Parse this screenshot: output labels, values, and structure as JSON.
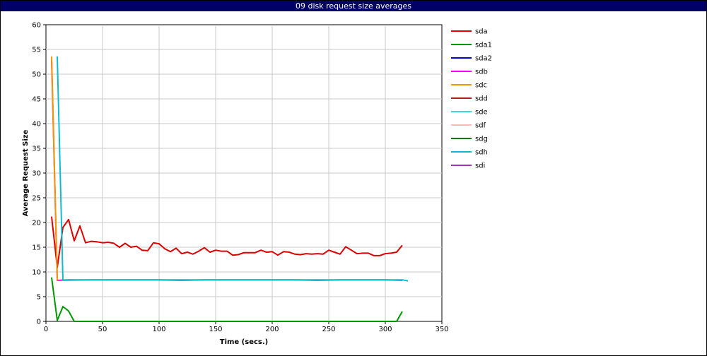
{
  "chart_data": {
    "type": "line",
    "title": "09 disk request size averages",
    "xlabel": "Time (secs.)",
    "ylabel": "Average Request Size",
    "xlim": [
      0,
      350
    ],
    "ylim": [
      0,
      60
    ],
    "xticks": [
      0,
      50,
      100,
      150,
      200,
      250,
      300,
      350
    ],
    "yticks": [
      0,
      5,
      10,
      15,
      20,
      25,
      30,
      35,
      40,
      45,
      50,
      55,
      60
    ],
    "grid": true,
    "legend_position": "right",
    "series": [
      {
        "name": "sda",
        "color": "#dd0000",
        "points": [
          [
            5,
            21.2
          ],
          [
            10,
            10.9
          ],
          [
            15,
            19
          ],
          [
            20,
            20.6
          ],
          [
            25,
            16.3
          ],
          [
            30,
            19.3
          ],
          [
            35,
            15.9
          ],
          [
            40,
            16.2
          ],
          [
            45,
            16.1
          ],
          [
            50,
            15.9
          ],
          [
            55,
            16
          ],
          [
            60,
            15.8
          ],
          [
            65,
            15
          ],
          [
            70,
            15.8
          ],
          [
            75,
            15
          ],
          [
            80,
            15.2
          ],
          [
            85,
            14.4
          ],
          [
            90,
            14.3
          ],
          [
            95,
            15.9
          ],
          [
            100,
            15.7
          ],
          [
            105,
            14.7
          ],
          [
            110,
            14.1
          ],
          [
            115,
            14.8
          ],
          [
            120,
            13.7
          ],
          [
            125,
            14
          ],
          [
            130,
            13.6
          ],
          [
            135,
            14.2
          ],
          [
            140,
            14.9
          ],
          [
            145,
            14
          ],
          [
            150,
            14.4
          ],
          [
            155,
            14.2
          ],
          [
            160,
            14.2
          ],
          [
            165,
            13.4
          ],
          [
            170,
            13.5
          ],
          [
            175,
            13.9
          ],
          [
            180,
            13.9
          ],
          [
            185,
            13.9
          ],
          [
            190,
            14.4
          ],
          [
            195,
            14
          ],
          [
            200,
            14.1
          ],
          [
            205,
            13.4
          ],
          [
            210,
            14.1
          ],
          [
            215,
            14
          ],
          [
            220,
            13.6
          ],
          [
            225,
            13.5
          ],
          [
            230,
            13.7
          ],
          [
            235,
            13.6
          ],
          [
            240,
            13.7
          ],
          [
            245,
            13.6
          ],
          [
            250,
            14.4
          ],
          [
            255,
            14
          ],
          [
            260,
            13.6
          ],
          [
            265,
            15.1
          ],
          [
            270,
            14.4
          ],
          [
            275,
            13.7
          ],
          [
            280,
            13.8
          ],
          [
            285,
            13.8
          ],
          [
            290,
            13.3
          ],
          [
            295,
            13.3
          ],
          [
            300,
            13.7
          ],
          [
            305,
            13.8
          ],
          [
            310,
            14
          ],
          [
            315,
            15.4
          ]
        ]
      },
      {
        "name": "sda1",
        "color": "#009900",
        "points": [
          [
            5,
            8.9
          ],
          [
            10,
            0.2
          ],
          [
            15,
            3
          ],
          [
            20,
            2.1
          ],
          [
            25,
            0
          ],
          [
            30,
            0
          ],
          [
            310,
            0
          ],
          [
            315,
            2
          ]
        ]
      },
      {
        "name": "sda2",
        "color": "#0000cc",
        "points": []
      },
      {
        "name": "sdb",
        "color": "#ff00ff",
        "points": [
          [
            5,
            52.8
          ],
          [
            10,
            8.3
          ],
          [
            20,
            8.4
          ],
          [
            40,
            8.4
          ],
          [
            60,
            8.4
          ],
          [
            80,
            8.4
          ],
          [
            100,
            8.4
          ],
          [
            120,
            8.3
          ],
          [
            140,
            8.4
          ],
          [
            160,
            8.4
          ],
          [
            180,
            8.4
          ],
          [
            200,
            8.4
          ],
          [
            220,
            8.4
          ],
          [
            240,
            8.3
          ],
          [
            260,
            8.4
          ],
          [
            280,
            8.4
          ],
          [
            300,
            8.4
          ],
          [
            315,
            8.3
          ]
        ]
      },
      {
        "name": "sdc",
        "color": "#ee9900",
        "points": [
          [
            5,
            53.6
          ],
          [
            10,
            8.3
          ]
        ]
      },
      {
        "name": "sdd",
        "color": "#aa2222",
        "points": []
      },
      {
        "name": "sde",
        "color": "#33dddd",
        "points": []
      },
      {
        "name": "sdf",
        "color": "#ffbbbb",
        "points": []
      },
      {
        "name": "sdg",
        "color": "#117711",
        "points": []
      },
      {
        "name": "sdh",
        "color": "#11bbcc",
        "points": [
          [
            10,
            53.6
          ],
          [
            15,
            8.3
          ],
          [
            40,
            8.4
          ],
          [
            100,
            8.4
          ],
          [
            160,
            8.4
          ],
          [
            220,
            8.4
          ],
          [
            280,
            8.4
          ],
          [
            315,
            8.4
          ],
          [
            320,
            8.2
          ]
        ]
      },
      {
        "name": "sdi",
        "color": "#aa33bb",
        "points": []
      }
    ]
  }
}
